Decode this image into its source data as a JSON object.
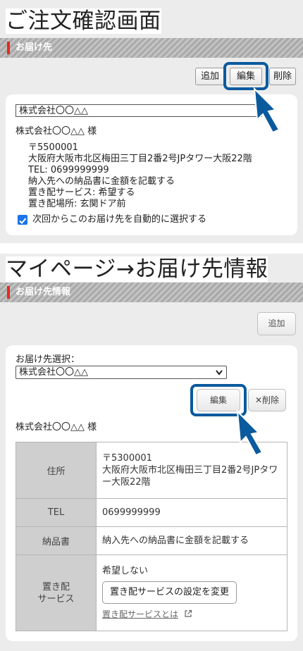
{
  "section1": {
    "title": "ご注文確認画面",
    "bar_title": "お届け先",
    "buttons": {
      "add": "追加",
      "edit": "編集",
      "delete": "削除"
    },
    "selected": "株式会社〇〇△△",
    "name": "株式会社〇〇△△ 様",
    "address_lines": [
      "〒5500001",
      "大阪府大阪市北区梅田三丁目2番2号JPタワー大阪22階",
      "TEL: 0699999999",
      "納入先への納品書に金額を記載する",
      "置き配サービス: 希望する",
      "置き配場所: 玄関ドア前"
    ],
    "auto_select_label": "次回からこのお届け先を自動的に選択する"
  },
  "section2": {
    "title": "マイページ→お届け先情報",
    "bar_title": "お届け先情報",
    "add_button": "追加",
    "select_label": "お届け先選択：",
    "selected": "株式会社〇〇△△",
    "edit_button": "編集",
    "delete_button": "削除",
    "name": "株式会社〇〇△△ 様",
    "table": {
      "address_label": "住所",
      "address_lines": [
        "〒5300001",
        "大阪府大阪市北区梅田三丁目2番2号JPタワ",
        "ー大阪22階"
      ],
      "tel_label": "TEL",
      "tel_value": "0699999999",
      "invoice_label": "納品書",
      "invoice_value": "納入先への納品書に金額を記載する",
      "okihai_label_lines": [
        "置き配",
        "サービス"
      ],
      "okihai_value": "希望しない",
      "okihai_button": "置き配サービスの設定を変更",
      "okihai_link": "置き配サービスとは"
    }
  },
  "colors": {
    "highlight": "#0a5a9e",
    "accent_red": "#e8291c"
  }
}
